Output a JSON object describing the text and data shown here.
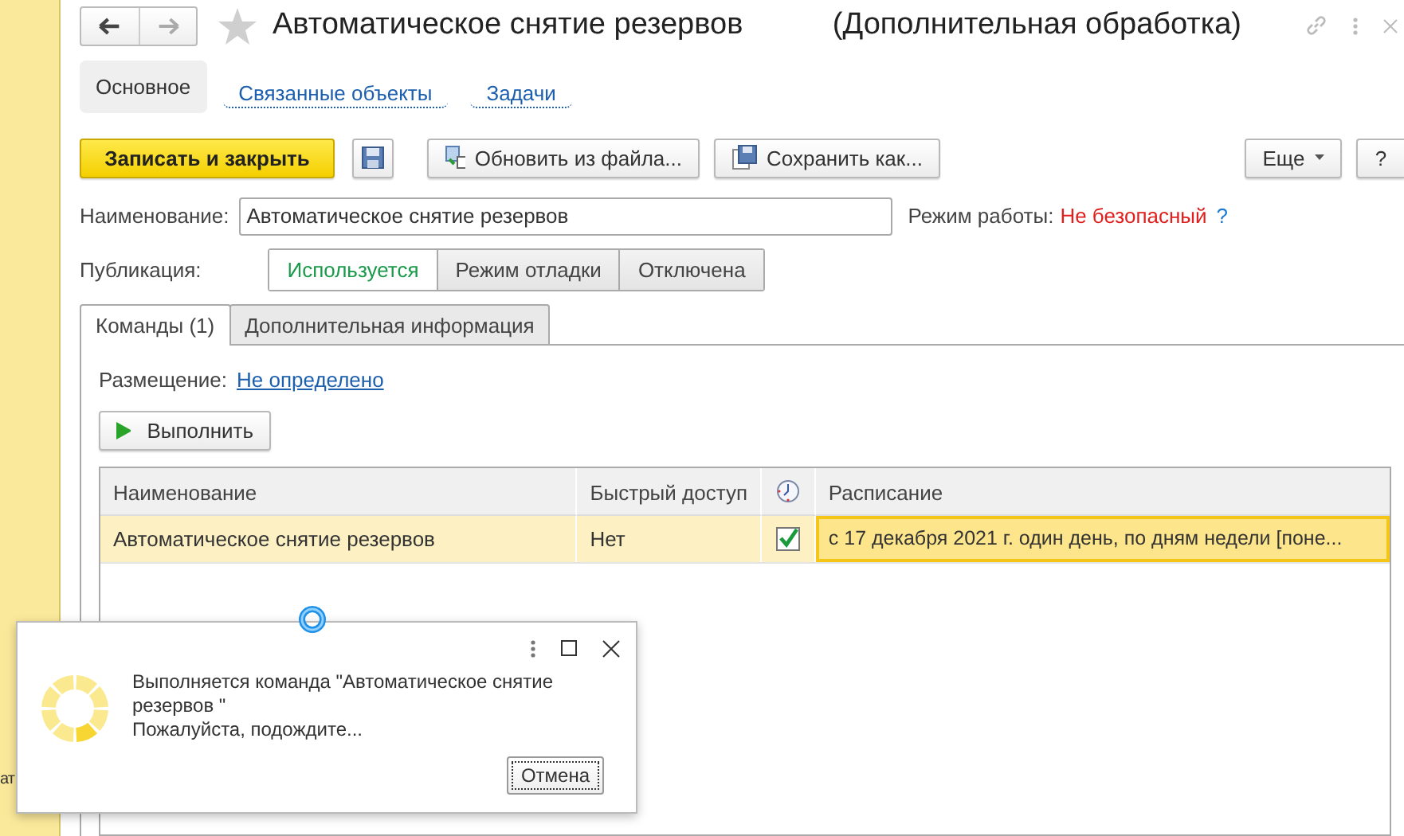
{
  "sidebar": {
    "text": "ат"
  },
  "window": {
    "title": "Автоматическое снятие резервов",
    "subtitle": "(Дополнительная обработка)"
  },
  "nav": [
    {
      "label": "Основное",
      "selected": true
    },
    {
      "label": "Связанные объекты",
      "selected": false
    },
    {
      "label": "Задачи",
      "selected": false
    }
  ],
  "toolbar": {
    "primary": "Записать и закрыть",
    "buttons": [
      "Обновить из файла...",
      "Сохранить как..."
    ],
    "more": "Еще",
    "help": "?"
  },
  "fields": {
    "name_label": "Наименование:",
    "name_value": "Автоматическое снятие резервов",
    "mode_label": "Режим работы:",
    "mode_value": "Не безопасный",
    "mode_help": "?"
  },
  "publication": {
    "label": "Публикация:",
    "options": [
      {
        "label": "Используется",
        "selected": true
      },
      {
        "label": "Режим отладки",
        "selected": false
      },
      {
        "label": "Отключена",
        "selected": false
      }
    ]
  },
  "tabs": [
    {
      "label": "Команды (1)",
      "selected": true
    },
    {
      "label": "Дополнительная информация",
      "selected": false
    }
  ],
  "placement": {
    "label": "Размещение:",
    "value": "Не определено"
  },
  "run_button": "Выполнить",
  "table": {
    "columns": [
      {
        "kind": "text",
        "label": "Наименование"
      },
      {
        "kind": "text",
        "label": "Быстрый доступ"
      },
      {
        "kind": "clock"
      },
      {
        "kind": "text",
        "label": "Расписание"
      }
    ],
    "rows": [
      {
        "name": "Автоматическое снятие резервов",
        "quick_access": "Нет",
        "scheduled": true,
        "schedule": "с 17 декабря 2021 г. один день, по дням недели [поне...",
        "selected": true
      }
    ]
  },
  "dialog": {
    "message": "Выполняется команда \"Автоматическое снятие резервов \"",
    "hint": "Пожалуйста, подождите...",
    "cancel": "Отмена"
  }
}
